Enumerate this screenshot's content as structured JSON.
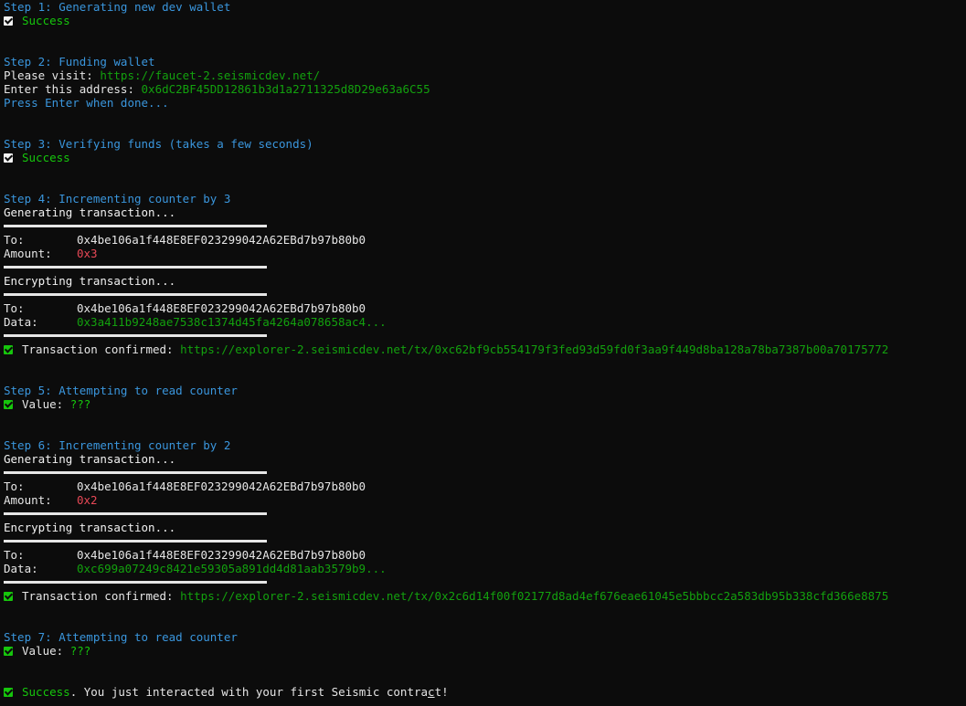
{
  "step1": {
    "title": "Step 1: Generating new dev wallet",
    "status": "Success"
  },
  "step2": {
    "title": "Step 2: Funding wallet",
    "visit_label": "Please visit: ",
    "visit_url": "https://faucet-2.seismicdev.net/",
    "address_label": "Enter this address: ",
    "address": "0x6dC2BF45DD12861b3d1a2711325d8D29e63a6C55",
    "prompt": "Press Enter when done..."
  },
  "step3": {
    "title": "Step 3: Verifying funds (takes a few seconds)",
    "status": "Success"
  },
  "step4": {
    "title": "Step 4: Incrementing counter by 3",
    "generating": "Generating transaction...",
    "to_label": "To:",
    "to": "0x4be106a1f448E8EF023299042A62EBd7b97b80b0",
    "amount_label": "Amount:",
    "amount": "0x3",
    "encrypting": "Encrypting transaction...",
    "to2": "0x4be106a1f448E8EF023299042A62EBd7b97b80b0",
    "data_label": "Data:",
    "data": "0x3a411b9248ae7538c1374d45fa4264a078658ac4...",
    "confirmed_label": "Transaction confirmed: ",
    "confirmed_url": "https://explorer-2.seismicdev.net/tx/0xc62bf9cb554179f3fed93d59fd0f3aa9f449d8ba128a78ba7387b00a70175772"
  },
  "step5": {
    "title": "Step 5: Attempting to read counter",
    "value_label": "Value: ",
    "value": "???"
  },
  "step6": {
    "title": "Step 6: Incrementing counter by 2",
    "generating": "Generating transaction...",
    "to_label": "To:",
    "to": "0x4be106a1f448E8EF023299042A62EBd7b97b80b0",
    "amount_label": "Amount:",
    "amount": "0x2",
    "encrypting": "Encrypting transaction...",
    "to2": "0x4be106a1f448E8EF023299042A62EBd7b97b80b0",
    "data_label": "Data:",
    "data": "0xc699a07249c8421e59305a891dd4d81aab3579b9...",
    "confirmed_label": "Transaction confirmed: ",
    "confirmed_url": "https://explorer-2.seismicdev.net/tx/0x2c6d14f00f02177d8ad4ef676eae61045e5bbbcc2a583db95b338cfd366e8875"
  },
  "step7": {
    "title": "Step 7: Attempting to read counter",
    "value_label": "Value: ",
    "value": "???"
  },
  "final": {
    "success": "Success",
    "message_main": ". You just interacted with your first Seismic contra",
    "message_cursor": "c",
    "message_end": "t!"
  },
  "colors": {
    "background": "#0c0c0c",
    "heading": "#3a96dd",
    "success": "#16c60c",
    "link": "#13a10e",
    "amount": "#e74856"
  }
}
